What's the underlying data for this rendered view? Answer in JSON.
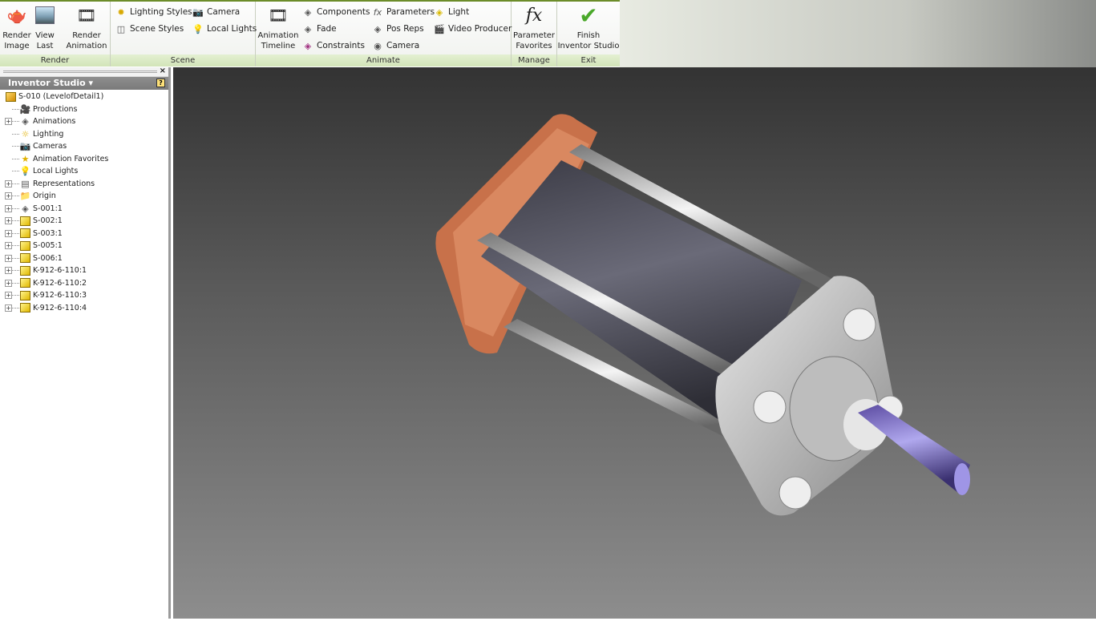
{
  "ribbon": {
    "render": {
      "label": "Render",
      "render_image": [
        "Render",
        "Image"
      ],
      "view_last": [
        "View",
        "Last"
      ],
      "render_animation": [
        "Render",
        "Animation"
      ]
    },
    "scene": {
      "label": "Scene",
      "lighting_styles": "Lighting Styles",
      "scene_styles": "Scene Styles",
      "camera": "Camera",
      "local_lights": "Local Lights"
    },
    "animate": {
      "label": "Animate",
      "animation_timeline": [
        "Animation",
        "Timeline"
      ],
      "components": "Components",
      "fade": "Fade",
      "constraints": "Constraints",
      "parameters": "Parameters",
      "pos_reps": "Pos Reps",
      "camera": "Camera",
      "light": "Light",
      "video_producer": "Video Producer"
    },
    "manage": {
      "label": "Manage",
      "parameter_favorites": [
        "Parameter",
        "Favorites"
      ]
    },
    "exit": {
      "label": "Exit",
      "finish": [
        "Finish",
        "Inventor Studio"
      ]
    }
  },
  "panel": {
    "title": "Inventor Studio ▾",
    "close": "×",
    "help": "?",
    "root": "S-010 (LevelofDetail1)",
    "items": [
      {
        "label": "Productions",
        "expandable": false,
        "icon": "productions-icon"
      },
      {
        "label": "Animations",
        "expandable": true,
        "icon": "animations-icon"
      },
      {
        "label": "Lighting",
        "expandable": false,
        "icon": "lighting-icon"
      },
      {
        "label": "Cameras",
        "expandable": false,
        "icon": "cameras-icon"
      },
      {
        "label": "Animation Favorites",
        "expandable": false,
        "icon": "star-icon"
      },
      {
        "label": "Local Lights",
        "expandable": false,
        "icon": "bulb-icon"
      },
      {
        "label": "Representations",
        "expandable": true,
        "icon": "representations-icon"
      },
      {
        "label": "Origin",
        "expandable": true,
        "icon": "folder-icon"
      },
      {
        "label": "S-001:1",
        "expandable": true,
        "icon": "subassembly-icon"
      },
      {
        "label": "S-002:1",
        "expandable": true,
        "icon": "part-icon"
      },
      {
        "label": "S-003:1",
        "expandable": true,
        "icon": "part-icon"
      },
      {
        "label": "S-005:1",
        "expandable": true,
        "icon": "part-icon"
      },
      {
        "label": "S-006:1",
        "expandable": true,
        "icon": "part-icon"
      },
      {
        "label": "K-912-6-110:1",
        "expandable": true,
        "icon": "part-icon"
      },
      {
        "label": "K-912-6-110:2",
        "expandable": true,
        "icon": "part-icon"
      },
      {
        "label": "K-912-6-110:3",
        "expandable": true,
        "icon": "part-icon"
      },
      {
        "label": "K-912-6-110:4",
        "expandable": true,
        "icon": "part-icon"
      }
    ]
  },
  "colors": {
    "ribbon_group_label": "#d2e4b8",
    "flange": "#c8714a",
    "bolt": "#8878d8",
    "finish_check": "#4aa82a"
  }
}
